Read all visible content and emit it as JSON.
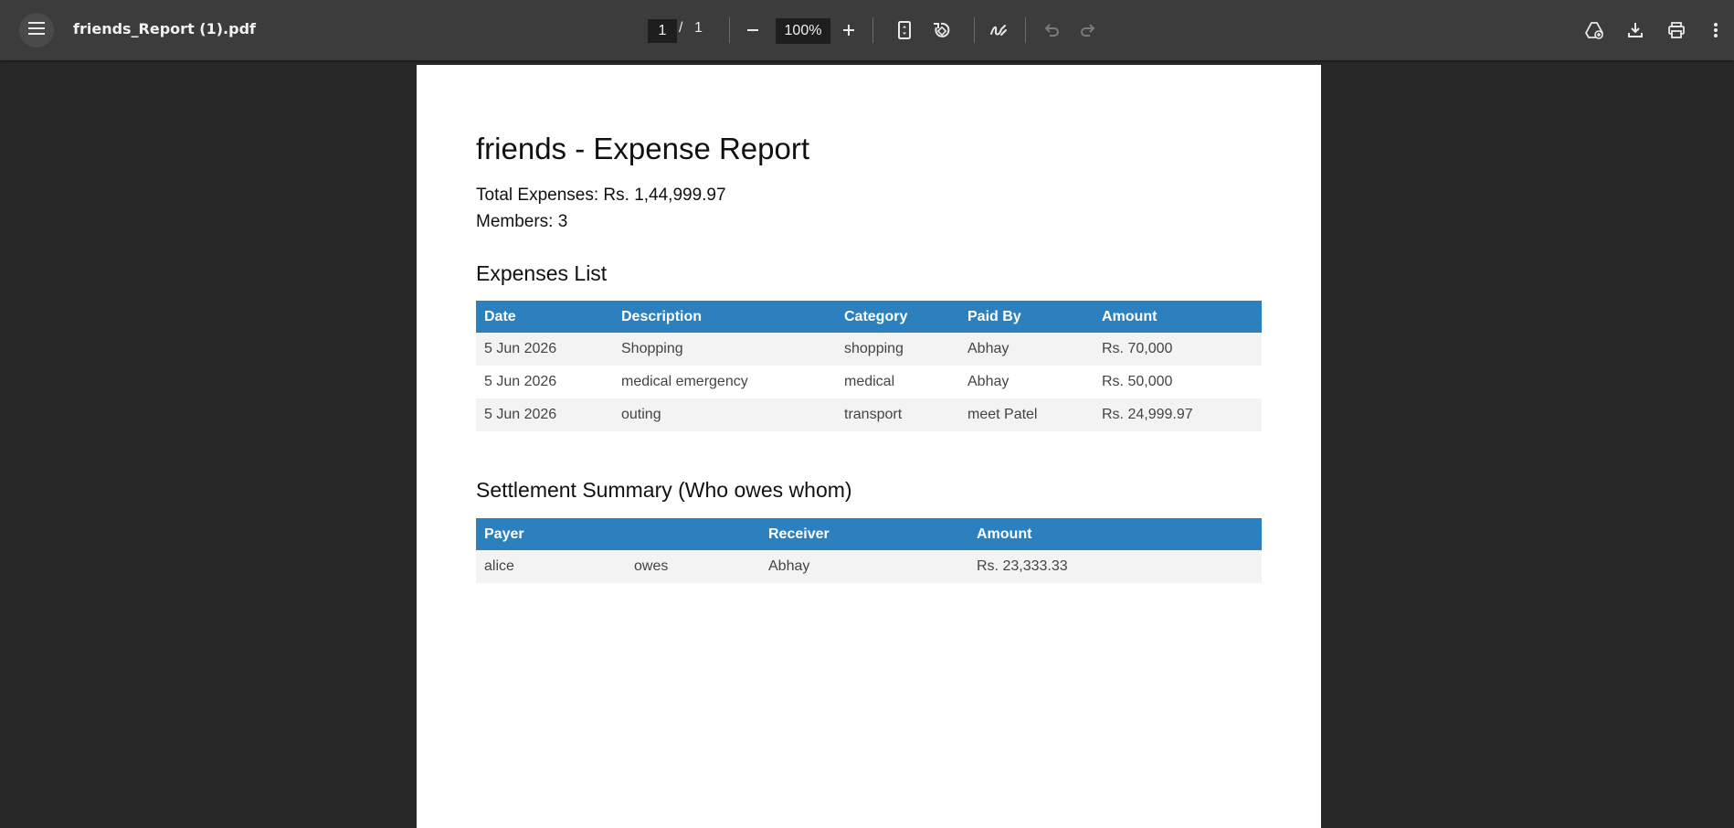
{
  "viewer": {
    "file_name": "friends_Report (1).pdf",
    "current_page": "1",
    "page_separator": "/",
    "total_pages": "1",
    "zoom": "100%"
  },
  "report": {
    "title": "friends - Expense Report",
    "total_expenses": "Total Expenses: Rs. 1,44,999.97",
    "members": "Members: 3",
    "expenses_heading": "Expenses List",
    "expenses_columns": [
      "Date",
      "Description",
      "Category",
      "Paid By",
      "Amount"
    ],
    "expenses_rows": [
      [
        "5 Jun 2026",
        "Shopping",
        "shopping",
        "Abhay",
        "Rs. 70,000"
      ],
      [
        "5 Jun 2026",
        "medical emergency",
        "medical",
        "Abhay",
        "Rs. 50,000"
      ],
      [
        "5 Jun 2026",
        "outing",
        "transport",
        "meet Patel",
        "Rs. 24,999.97"
      ]
    ],
    "settlement_heading": "Settlement Summary (Who owes whom)",
    "settlement_columns": [
      "Payer",
      "",
      "Receiver",
      "Amount"
    ],
    "settlement_rows": [
      [
        "alice",
        "owes",
        "Abhay",
        "Rs. 23,333.33"
      ]
    ]
  },
  "colors": {
    "toolbar": "#3c3c3c",
    "background": "#282828",
    "table_header": "#2b80bd"
  },
  "icons": [
    "menu-icon",
    "zoom-out-icon",
    "zoom-in-icon",
    "fit-page-icon",
    "rotate-icon",
    "annotate-icon",
    "undo-icon",
    "redo-icon",
    "save-to-drive-icon",
    "download-icon",
    "print-icon",
    "more-vert-icon"
  ]
}
